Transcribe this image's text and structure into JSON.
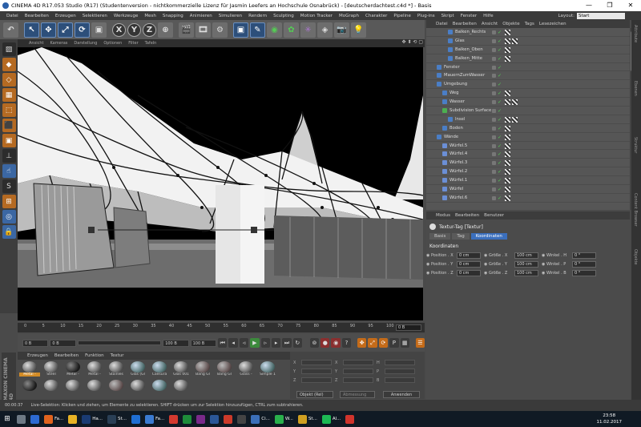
{
  "window": {
    "title": "CINEMA 4D R17.053 Studio (R17) (Studentenversion - nichtkommerzielle Lizenz für Jasmin Leefers an Hochschule Osnabrück) - [deutscherdachtest.c4d *] - Basis",
    "min": "—",
    "max": "❐",
    "close": "✕"
  },
  "menu": [
    "Datei",
    "Bearbeiten",
    "Erzeugen",
    "Selektieren",
    "Werkzeuge",
    "Mesh",
    "Snapping",
    "Animieren",
    "Simulieren",
    "Rendern",
    "Sculpting",
    "Motion Tracker",
    "MoGraph",
    "Charakter",
    "Pipeline",
    "Plug-ins",
    "Skript",
    "Fenster",
    "Hilfe"
  ],
  "layout": {
    "label": "Layout:",
    "value": "Start"
  },
  "toolbar": {
    "x": "X",
    "y": "Y",
    "z": "Z"
  },
  "viewport": {
    "menu": [
      "Ansicht",
      "Kameras",
      "Darstellung",
      "Optionen",
      "Filter",
      "Tafeln"
    ],
    "nav": "✥ ⬍ ⟲ ▢"
  },
  "timeline": {
    "ticks": [
      "0",
      "5",
      "10",
      "15",
      "20",
      "25",
      "30",
      "35",
      "40",
      "45",
      "50",
      "55",
      "60",
      "65",
      "70",
      "75",
      "80",
      "85",
      "90",
      "95",
      "100"
    ],
    "frame": "0 B"
  },
  "playback": {
    "start": "0 B",
    "cur": "0 B",
    "end": "100 B",
    "end2": "100 B"
  },
  "materials": {
    "menu": [
      "Erzeugen",
      "Bearbeiten",
      "Funktion",
      "Textur"
    ],
    "items": [
      {
        "label": "Metal -",
        "kind": "metal",
        "sel": true
      },
      {
        "label": "Steel",
        "kind": "metal"
      },
      {
        "label": "Metal -",
        "kind": "dark"
      },
      {
        "label": "Metal -",
        "kind": "metal"
      },
      {
        "label": "Stainles",
        "kind": "metal"
      },
      {
        "label": "Glas (Gl",
        "kind": "glass"
      },
      {
        "label": "Caesura",
        "kind": "glass"
      },
      {
        "label": "Glas 001",
        "kind": "metal"
      },
      {
        "label": "Bang Gl",
        "kind": "rough"
      },
      {
        "label": "Bang Gl",
        "kind": "rough"
      },
      {
        "label": "Glass -",
        "kind": "metal"
      },
      {
        "label": "Simple 1",
        "kind": "glass"
      },
      {
        "label": "",
        "kind": "dark"
      },
      {
        "label": "",
        "kind": "metal"
      },
      {
        "label": "",
        "kind": "metal"
      },
      {
        "label": "",
        "kind": "metal"
      },
      {
        "label": "",
        "kind": "rough"
      },
      {
        "label": "",
        "kind": "metal"
      },
      {
        "label": "",
        "kind": "glass"
      },
      {
        "label": "",
        "kind": "metal"
      }
    ],
    "brand": "MAXON CINEMA 4D"
  },
  "coordmgr": {
    "rows": [
      {
        "a": "X",
        "av": "",
        "b": "X",
        "bv": "",
        "c": "H",
        "cv": ""
      },
      {
        "a": "Y",
        "av": "",
        "b": "Y",
        "bv": "",
        "c": "P",
        "cv": ""
      },
      {
        "a": "Z",
        "av": "",
        "b": "Z",
        "bv": "",
        "c": "B",
        "cv": ""
      }
    ],
    "obj": "Objekt (Rel)",
    "abm": "Abmessung",
    "apply": "Anwenden"
  },
  "status": {
    "time": "00:00:37",
    "text": "Live-Selektion: Klicken und ziehen, um Elemente zu selektieren. SHIFT drücken um zur Selektion hinzuzufügen, CTRL zum subtrahieren."
  },
  "taskbar": {
    "items": [
      {
        "label": "",
        "color": "#6e7a85"
      },
      {
        "label": "",
        "color": "#2d6ad1"
      },
      {
        "label": "Fa...",
        "color": "#e0631e"
      },
      {
        "label": "",
        "color": "#e8b325"
      },
      {
        "label": "Ha...",
        "color": "#1a3b72"
      },
      {
        "label": "St...",
        "color": "#2a3f55"
      },
      {
        "label": "",
        "color": "#1f6fd3"
      },
      {
        "label": "Fa...",
        "color": "#3b7bd1"
      },
      {
        "label": "",
        "color": "#d33a2f"
      },
      {
        "label": "",
        "color": "#1e8c3a"
      },
      {
        "label": "",
        "color": "#7a2a8a"
      },
      {
        "label": "",
        "color": "#2b5797"
      },
      {
        "label": "",
        "color": "#cc3a2a"
      },
      {
        "label": "",
        "color": "#444444"
      },
      {
        "label": "Ci...",
        "color": "#3b6fb8"
      },
      {
        "label": "W...",
        "color": "#2ab04c"
      },
      {
        "label": "St...",
        "color": "#d0a021"
      },
      {
        "label": "Al...",
        "color": "#1db954"
      },
      {
        "label": "",
        "color": "#d0342c"
      }
    ],
    "time": "23:58",
    "date": "11.02.2017"
  },
  "objmgr": {
    "tabs": [
      "Datei",
      "Bearbeiten",
      "Ansicht",
      "Objekte",
      "Tags",
      "Lesezeichen"
    ],
    "rows": [
      {
        "label": "Balken_Rechts",
        "indent": 3,
        "tags": 1
      },
      {
        "label": "Glas",
        "indent": 3,
        "tags": 2
      },
      {
        "label": "Balken_Oben",
        "indent": 3,
        "tags": 1
      },
      {
        "label": "Balken_Mitte",
        "indent": 3,
        "tags": 1
      },
      {
        "label": "Fenster",
        "indent": 1,
        "tags": 0
      },
      {
        "label": "MauernZumWasser",
        "indent": 1,
        "tags": 0
      },
      {
        "label": "Umgebung",
        "indent": 1,
        "tags": 0
      },
      {
        "label": "Weg",
        "indent": 2,
        "tags": 1
      },
      {
        "label": "Wasser",
        "indent": 2,
        "tags": 2
      },
      {
        "label": "Subdivision Surface",
        "indent": 2,
        "tags": 0
      },
      {
        "label": "Insel",
        "indent": 3,
        "tags": 2
      },
      {
        "label": "Boden",
        "indent": 2,
        "tags": 1
      },
      {
        "label": "Wände",
        "indent": 1,
        "tags": 1
      },
      {
        "label": "Würfel.5",
        "indent": 2,
        "tags": 1
      },
      {
        "label": "Würfel.4",
        "indent": 2,
        "tags": 1
      },
      {
        "label": "Würfel.3",
        "indent": 2,
        "tags": 1
      },
      {
        "label": "Würfel.2",
        "indent": 2,
        "tags": 1
      },
      {
        "label": "Würfel.1",
        "indent": 2,
        "tags": 1
      },
      {
        "label": "Würfel",
        "indent": 2,
        "tags": 1
      },
      {
        "label": "Würfel.6",
        "indent": 2,
        "tags": 1
      }
    ]
  },
  "attr": {
    "tabs": [
      "Modus",
      "Bearbeiten",
      "Benutzer"
    ],
    "title": "Textur-Tag [Textur]",
    "subtabs": [
      "Basis",
      "Tag",
      "Koordinaten"
    ],
    "section": "Koordinaten",
    "rows": [
      {
        "p": "Position . X",
        "pv": "0 cm",
        "g": "Größe . X",
        "gv": "100 cm",
        "w": "Winkel . H",
        "wv": "0 °"
      },
      {
        "p": "Position . Y",
        "pv": "0 cm",
        "g": "Größe . Y",
        "gv": "100 cm",
        "w": "Winkel . P",
        "wv": "0 °"
      },
      {
        "p": "Position . Z",
        "pv": "0 cm",
        "g": "Größe . Z",
        "gv": "100 cm",
        "w": "Winkel . B",
        "wv": "0 °"
      }
    ]
  },
  "rstrip": [
    "Attribute",
    "Ebenen",
    "Struktur",
    "Content Browser",
    "Objekte"
  ]
}
